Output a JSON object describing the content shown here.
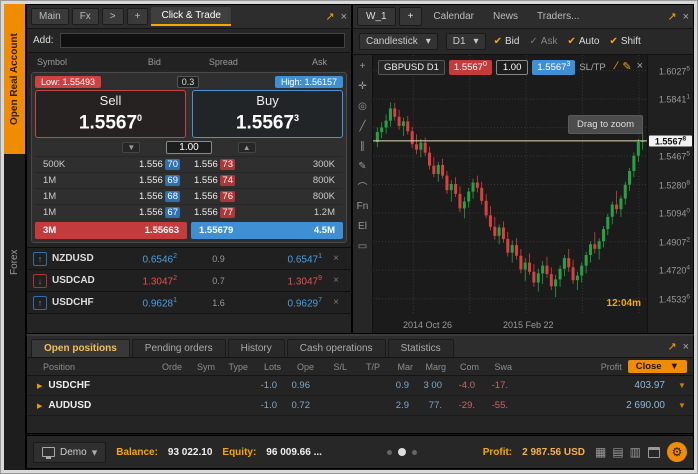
{
  "icons": {
    "close": "×",
    "maximize": "↗",
    "caret": "▾",
    "tri_up": "▲",
    "tri_down": "▼",
    "expand_right": "▶",
    "pencil": "✎",
    "gear": "⚙",
    "line": "∕"
  },
  "sidebar": {
    "open_real_account": "Open Real Account",
    "forex": "Forex"
  },
  "click_trade": {
    "tabs": [
      {
        "label": "Main"
      },
      {
        "label": "Fx"
      },
      {
        "label": ">"
      },
      {
        "label": "+"
      }
    ],
    "title": "Click & Trade",
    "add_label": "Add:",
    "columns": [
      "Symbol",
      "Bid",
      "Spread",
      "Ask"
    ],
    "low_label": "Low: 1.55493",
    "spread": "0.3",
    "high_label": "High: 1.56157",
    "sell_label": "Sell",
    "sell_price": "1.5567",
    "sell_sup": "0",
    "buy_label": "Buy",
    "buy_price": "1.5567",
    "buy_sup": "3",
    "volume": "1.00",
    "depth": [
      {
        "bid_size": "500K",
        "bid_pre": "1.556",
        "bid_hl": "70",
        "ask_pre": "1.556",
        "ask_hl": "73",
        "ask_size": "300K"
      },
      {
        "bid_size": "1M",
        "bid_pre": "1.556",
        "bid_hl": "69",
        "ask_pre": "1.556",
        "ask_hl": "74",
        "ask_size": "800K"
      },
      {
        "bid_size": "1M",
        "bid_pre": "1.556",
        "bid_hl": "68",
        "ask_pre": "1.556",
        "ask_hl": "76",
        "ask_size": "800K"
      },
      {
        "bid_size": "1M",
        "bid_pre": "1.556",
        "bid_hl": "67",
        "ask_pre": "1.556",
        "ask_hl": "77",
        "ask_size": "1.2M"
      }
    ],
    "best": {
      "bid_size": "3M",
      "bid": "1.55663",
      "ask": "1.55679",
      "ask_size": "4.5M"
    },
    "watchlist": [
      {
        "symbol": "NZDUSD",
        "dir": "up",
        "arrow": "↑",
        "bid": "0.6546",
        "bid_sup": "2",
        "spread": "0.9",
        "ask": "0.6547",
        "ask_sup": "1"
      },
      {
        "symbol": "USDCAD",
        "dir": "down",
        "arrow": "↓",
        "bid": "1.3047",
        "bid_sup": "2",
        "spread": "0.7",
        "ask": "1.3047",
        "ask_sup": "9"
      },
      {
        "symbol": "USDCHF",
        "dir": "up",
        "arrow": "↑",
        "bid": "0.9628",
        "bid_sup": "1",
        "spread": "1.6",
        "ask": "0.9629",
        "ask_sup": "7"
      }
    ]
  },
  "chart_panel": {
    "tabs": [
      {
        "label": "W_1",
        "cls": "chip"
      },
      {
        "label": "+",
        "cls": "chip"
      },
      {
        "label": "Calendar"
      },
      {
        "label": "News"
      },
      {
        "label": "Traders..."
      }
    ],
    "chart_type": "Candlestick",
    "timeframe": "D1",
    "toggles": [
      {
        "label": "Bid",
        "mark": "✔",
        "state": "on"
      },
      {
        "label": "Ask",
        "mark": "✓",
        "state": "off"
      },
      {
        "label": "Auto",
        "mark": "✔",
        "state": "on"
      },
      {
        "label": "Shift",
        "mark": "✔",
        "state": "on"
      }
    ],
    "tools": [
      {
        "glyph": "+"
      },
      {
        "glyph": "✛"
      },
      {
        "glyph": "◎"
      },
      {
        "glyph": "╱"
      },
      {
        "glyph": "∥"
      },
      {
        "glyph": "✎"
      },
      {
        "glyph": "⌒"
      },
      {
        "glyph": "Fn"
      },
      {
        "glyph": "El"
      },
      {
        "glyph": "▭"
      }
    ],
    "symbol_label": "GBPUSD D1",
    "bid_box": "1.5567",
    "bid_sup": "0",
    "volume": "1.00",
    "ask_box": "1.5567",
    "ask_sup": "3",
    "sltp_label": "SL/TP",
    "tooltip": "Drag to zoom",
    "countdown": "12:04m",
    "time_labels": [
      "2014 Oct 26",
      "2015 Feb 22"
    ],
    "scale": {
      "min": 1.444,
      "max": 1.613
    },
    "extra_gridline": 1.56543,
    "price_axis": [
      {
        "text": "1.6027",
        "sup": "5",
        "value": 1.60275
      },
      {
        "text": "1.5841",
        "sup": "1",
        "value": 1.58411
      },
      {
        "text": "1.5467",
        "sup": "5",
        "value": 1.54675
      },
      {
        "text": "1.5280",
        "sup": "8",
        "value": 1.52808
      },
      {
        "text": "1.5094",
        "sup": "0",
        "value": 1.5094
      },
      {
        "text": "1.4907",
        "sup": "2",
        "value": 1.49072
      },
      {
        "text": "1.4720",
        "sup": "4",
        "value": 1.47204
      },
      {
        "text": "1.4533",
        "sup": "6",
        "value": 1.45336
      }
    ],
    "current": {
      "text": "1.5567",
      "sup": "8",
      "value": 1.55678
    },
    "candles": [
      [
        1.556,
        1.5655,
        1.5525,
        1.5625
      ],
      [
        1.5625,
        1.569,
        1.5585,
        1.5655
      ],
      [
        1.5655,
        1.574,
        1.5615,
        1.57
      ],
      [
        1.57,
        1.582,
        1.566,
        1.578
      ],
      [
        1.578,
        1.5815,
        1.57,
        1.5725
      ],
      [
        1.5725,
        1.577,
        1.564,
        1.5665
      ],
      [
        1.5665,
        1.572,
        1.56,
        1.5695
      ],
      [
        1.5695,
        1.573,
        1.561,
        1.563
      ],
      [
        1.563,
        1.566,
        1.552,
        1.5545
      ],
      [
        1.5545,
        1.561,
        1.548,
        1.551
      ],
      [
        1.551,
        1.558,
        1.546,
        1.5555
      ],
      [
        1.5555,
        1.559,
        1.547,
        1.549
      ],
      [
        1.549,
        1.553,
        1.538,
        1.5405
      ],
      [
        1.5405,
        1.546,
        1.533,
        1.535
      ],
      [
        1.535,
        1.543,
        1.53,
        1.541
      ],
      [
        1.541,
        1.545,
        1.532,
        1.534
      ],
      [
        1.534,
        1.537,
        1.522,
        1.5245
      ],
      [
        1.5245,
        1.531,
        1.517,
        1.5285
      ],
      [
        1.5285,
        1.533,
        1.52,
        1.522
      ],
      [
        1.522,
        1.527,
        1.51,
        1.5125
      ],
      [
        1.5125,
        1.52,
        1.506,
        1.517
      ],
      [
        1.517,
        1.526,
        1.513,
        1.5235
      ],
      [
        1.5235,
        1.532,
        1.519,
        1.5295
      ],
      [
        1.5295,
        1.534,
        1.523,
        1.526
      ],
      [
        1.526,
        1.53,
        1.515,
        1.5175
      ],
      [
        1.5175,
        1.522,
        1.506,
        1.508
      ],
      [
        1.508,
        1.514,
        1.498,
        1.5005
      ],
      [
        1.5005,
        1.507,
        1.492,
        1.4945
      ],
      [
        1.4945,
        1.502,
        1.489,
        1.5
      ],
      [
        1.5,
        1.504,
        1.49,
        1.4925
      ],
      [
        1.4925,
        1.497,
        1.481,
        1.4835
      ],
      [
        1.4835,
        1.4915,
        1.477,
        1.4885
      ],
      [
        1.4885,
        1.493,
        1.479,
        1.4815
      ],
      [
        1.4815,
        1.486,
        1.47,
        1.4725
      ],
      [
        1.4725,
        1.48,
        1.465,
        1.477
      ],
      [
        1.477,
        1.483,
        1.469,
        1.471
      ],
      [
        1.471,
        1.476,
        1.461,
        1.464
      ],
      [
        1.464,
        1.473,
        1.458,
        1.47
      ],
      [
        1.47,
        1.478,
        1.463,
        1.475
      ],
      [
        1.475,
        1.481,
        1.467,
        1.4695
      ],
      [
        1.4695,
        1.474,
        1.459,
        1.4615
      ],
      [
        1.4615,
        1.469,
        1.4545,
        1.466
      ],
      [
        1.466,
        1.475,
        1.461,
        1.473
      ],
      [
        1.473,
        1.482,
        1.468,
        1.48
      ],
      [
        1.48,
        1.486,
        1.471,
        1.474
      ],
      [
        1.474,
        1.479,
        1.463,
        1.4655
      ],
      [
        1.4655,
        1.471,
        1.459,
        1.4685
      ],
      [
        1.4685,
        1.477,
        1.464,
        1.475
      ],
      [
        1.475,
        1.484,
        1.47,
        1.482
      ],
      [
        1.482,
        1.491,
        1.477,
        1.489
      ],
      [
        1.489,
        1.497,
        1.483,
        1.486
      ],
      [
        1.486,
        1.493,
        1.479,
        1.491
      ],
      [
        1.491,
        1.501,
        1.487,
        1.499
      ],
      [
        1.499,
        1.509,
        1.495,
        1.507
      ],
      [
        1.507,
        1.517,
        1.502,
        1.515
      ],
      [
        1.515,
        1.524,
        1.509,
        1.512
      ],
      [
        1.512,
        1.521,
        1.507,
        1.519
      ],
      [
        1.519,
        1.53,
        1.515,
        1.528
      ],
      [
        1.528,
        1.539,
        1.524,
        1.537
      ],
      [
        1.537,
        1.549,
        1.533,
        1.547
      ],
      [
        1.547,
        1.558,
        1.543,
        1.556
      ],
      [
        1.556,
        1.5625,
        1.551,
        1.5568
      ]
    ],
    "colors": {
      "up": "#25a244",
      "down": "#d94040",
      "price_line": "#e6ddb4"
    }
  },
  "positions": {
    "tabs": [
      {
        "label": "Open positions",
        "cls": "active"
      },
      {
        "label": "Pending orders"
      },
      {
        "label": "History"
      },
      {
        "label": "Cash operations"
      },
      {
        "label": "Statistics"
      }
    ],
    "position_col": "Position",
    "columns": [
      {
        "label": "Orde"
      },
      {
        "label": "Sym"
      },
      {
        "label": "Type"
      },
      {
        "label": "Lots"
      },
      {
        "label": "Ope"
      },
      {
        "label": "S/L"
      },
      {
        "label": "T/P"
      },
      {
        "label": "Mar"
      },
      {
        "label": "Marg"
      },
      {
        "label": "Com"
      },
      {
        "label": "Swa"
      }
    ],
    "profit_col": "Profit",
    "close_button": "Close",
    "rows": [
      {
        "symbol": "USDCHF",
        "lots": "-1.0",
        "open": "0.96",
        "sl": "",
        "tp": "",
        "mar": "0.9",
        "marg": "3 00",
        "com": "-4.0",
        "com_cls": "neg",
        "swa": "-17.",
        "swa_cls": "neg",
        "profit": "403.97"
      },
      {
        "symbol": "AUDUSD",
        "lots": "-1.0",
        "open": "0.72",
        "sl": "",
        "tp": "",
        "mar": "2.9",
        "marg": "77.",
        "com": "-29.",
        "com_cls": "neg",
        "swa": "-55.",
        "swa_cls": "neg",
        "profit": "2 690.00"
      }
    ]
  },
  "statusbar": {
    "account": "Demo",
    "balance_label": "Balance:",
    "balance_value": "93 022.10",
    "equity_label": "Equity:",
    "equity_value": "96 009.66 ...",
    "profit_label": "Profit:",
    "profit_value": "2 987.56 USD",
    "workspace_icons": [
      {
        "glyph": "▦"
      },
      {
        "glyph": "▤"
      },
      {
        "glyph": "▥"
      }
    ]
  }
}
